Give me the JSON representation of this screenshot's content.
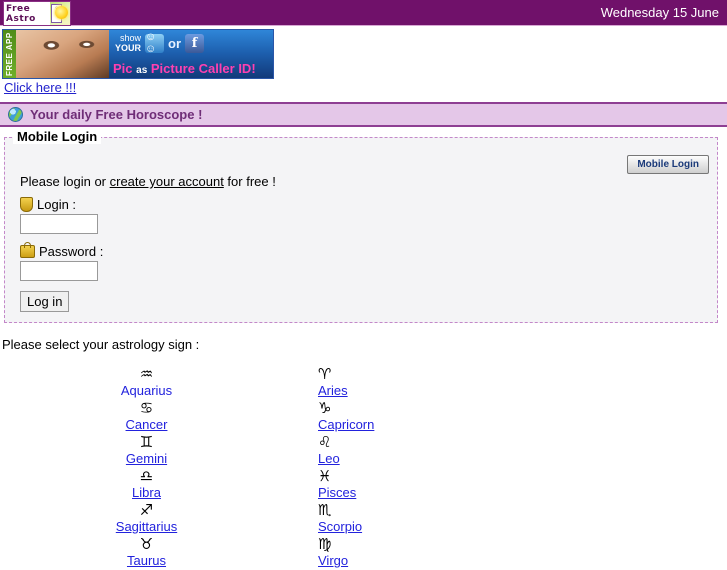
{
  "header": {
    "logo_line1": "Free",
    "logo_line2": "Astro",
    "logo_dial": "♀",
    "date": "Wednesday 15 June"
  },
  "ad": {
    "free_app_label": "FREE APP",
    "show_word": "show",
    "your_word": "YOUR",
    "myspace_icon_label": "☺☺",
    "or_word": "or",
    "facebook_icon_label": "f",
    "tagline_pic": "Pic",
    "tagline_as": "as",
    "tagline_rest": "Picture Caller ID!",
    "click_here": "Click here !!!"
  },
  "horoscope_bar": {
    "text": "Your daily Free Horoscope !",
    "icon": "globe-icon"
  },
  "login": {
    "legend": "Mobile Login",
    "mobile_login_button": "Mobile Login",
    "intro_prefix": "Please login or ",
    "intro_link": "create your account",
    "intro_suffix": " for free !",
    "login_label": "Login :",
    "password_label": "Password :",
    "login_value": "",
    "password_value": "",
    "submit_label": "Log in"
  },
  "signs": {
    "prompt": "Please select your astrology sign :",
    "rows": [
      {
        "left": {
          "name": "Aquarius",
          "glyph": "♒",
          "underlined": false
        },
        "right": {
          "name": "Aries",
          "glyph": "♈",
          "underlined": true
        }
      },
      {
        "left": {
          "name": "Cancer",
          "glyph": "♋",
          "underlined": true
        },
        "right": {
          "name": "Capricorn",
          "glyph": "♑",
          "underlined": true
        }
      },
      {
        "left": {
          "name": "Gemini",
          "glyph": "♊",
          "underlined": true
        },
        "right": {
          "name": "Leo",
          "glyph": "♌",
          "underlined": true
        }
      },
      {
        "left": {
          "name": "Libra",
          "glyph": "♎",
          "underlined": true
        },
        "right": {
          "name": "Pisces",
          "glyph": "♓",
          "underlined": true
        }
      },
      {
        "left": {
          "name": "Sagittarius",
          "glyph": "♐",
          "underlined": true
        },
        "right": {
          "name": "Scorpio",
          "glyph": "♏",
          "underlined": true
        }
      },
      {
        "left": {
          "name": "Taurus",
          "glyph": "♉",
          "underlined": true
        },
        "right": {
          "name": "Virgo",
          "glyph": "♍",
          "underlined": true
        }
      }
    ]
  },
  "colors": {
    "header_purple": "#70116A",
    "bar_fill": "#e4c7e8",
    "bar_border": "#8e3f93",
    "link_blue": "#2222dd",
    "fieldset_dash": "#c387c9"
  }
}
